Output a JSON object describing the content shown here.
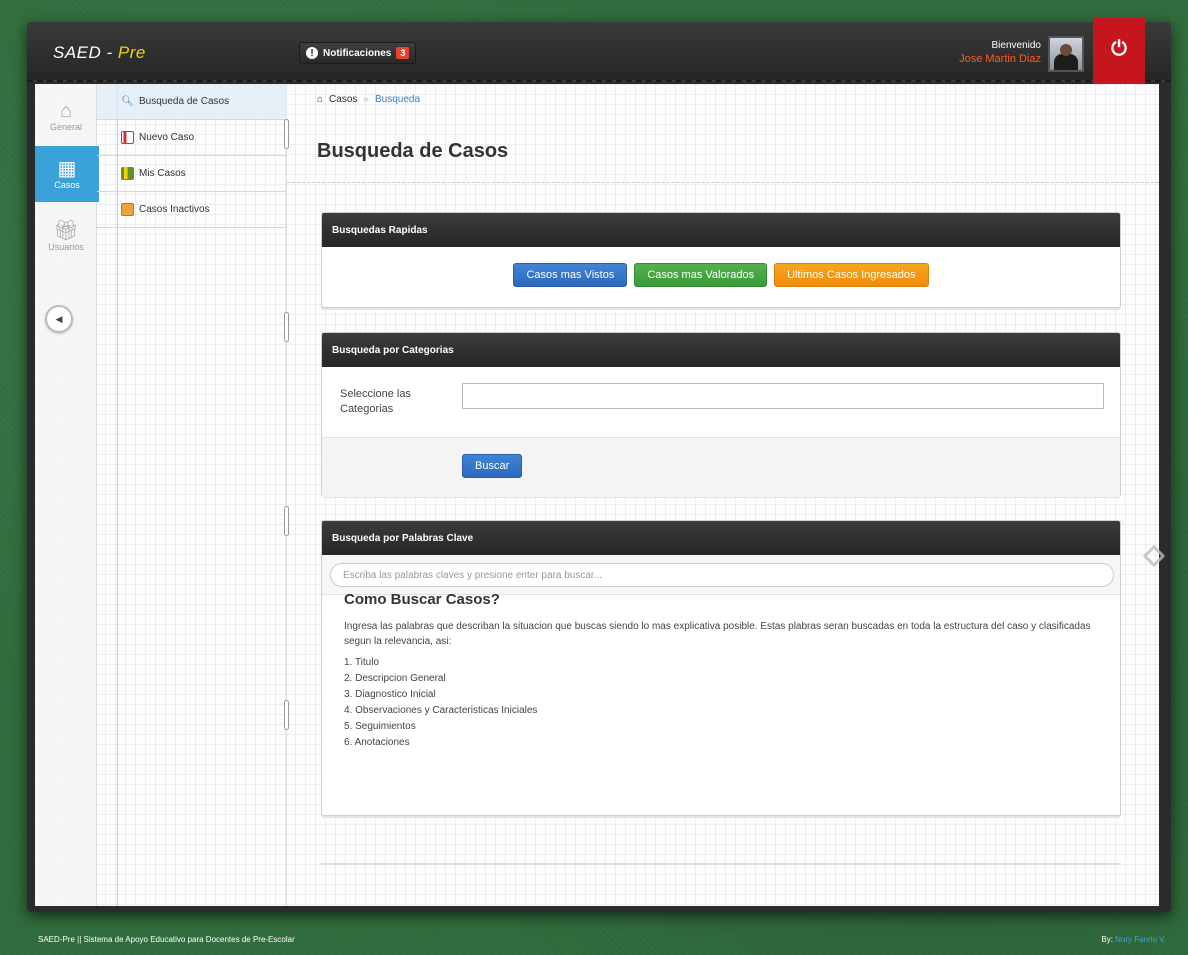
{
  "header": {
    "brand_main": "SAED - ",
    "brand_accent": "Pre",
    "notifications_label": "Notificaciones",
    "notifications_count": "3",
    "welcome_label": "Bienvenido",
    "user_name": "Jose Martin Diaz"
  },
  "iconbar": {
    "items": [
      {
        "label": "General",
        "icon": "home-icon"
      },
      {
        "label": "Casos",
        "icon": "grid-icon"
      },
      {
        "label": "Usuarios",
        "icon": "gift-icon"
      }
    ]
  },
  "submenu": {
    "items": [
      {
        "label": "Busqueda de Casos",
        "icon": "magnifier-icon"
      },
      {
        "label": "Nuevo Caso",
        "icon": "document-icon"
      },
      {
        "label": "Mis Casos",
        "icon": "book-icon"
      },
      {
        "label": "Casos Inactivos",
        "icon": "folder-icon"
      }
    ]
  },
  "breadcrumb": {
    "root": "Casos",
    "separator": "»",
    "current": "Busqueda"
  },
  "page": {
    "title": "Busqueda de Casos"
  },
  "quick_search": {
    "title": "Busquedas Rapidas",
    "buttons": [
      "Casos mas Vistos",
      "Casos mas Valorados",
      "Ultimos Casos Ingresados"
    ]
  },
  "category_search": {
    "title": "Busqueda por Categorias",
    "field_label": "Seleccione las Categorias",
    "field_value": "",
    "submit": "Buscar"
  },
  "keyword_search": {
    "title": "Busqueda por Palabras Clave",
    "placeholder": "Escriba las palabras claves y presione enter para buscar...",
    "help_title": "Como Buscar Casos?",
    "help_text": "Ingresa las palabras que describan la situacion que buscas siendo lo mas explicativa posible. Estas plabras seran buscadas en toda la estructura del caso y clasificadas segun la relevancia, asi:",
    "help_list": [
      "1. Titulo",
      "2. Descripcion General",
      "3. Diagnostico Inicial",
      "4. Observaciones y Caracteristicas Iniciales",
      "5. Seguimientos",
      "6. Anotaciones"
    ]
  },
  "footer": {
    "left": "SAED-Pre || Sistema de Apoyo Educativo para Docentes de Pre-Escolar",
    "by_label": "By:",
    "author": "Nury Farelo V."
  },
  "colors": {
    "accent_blue": "#3aa2d9",
    "brand_yellow": "#f2d20a",
    "power_red": "#c4161c"
  }
}
